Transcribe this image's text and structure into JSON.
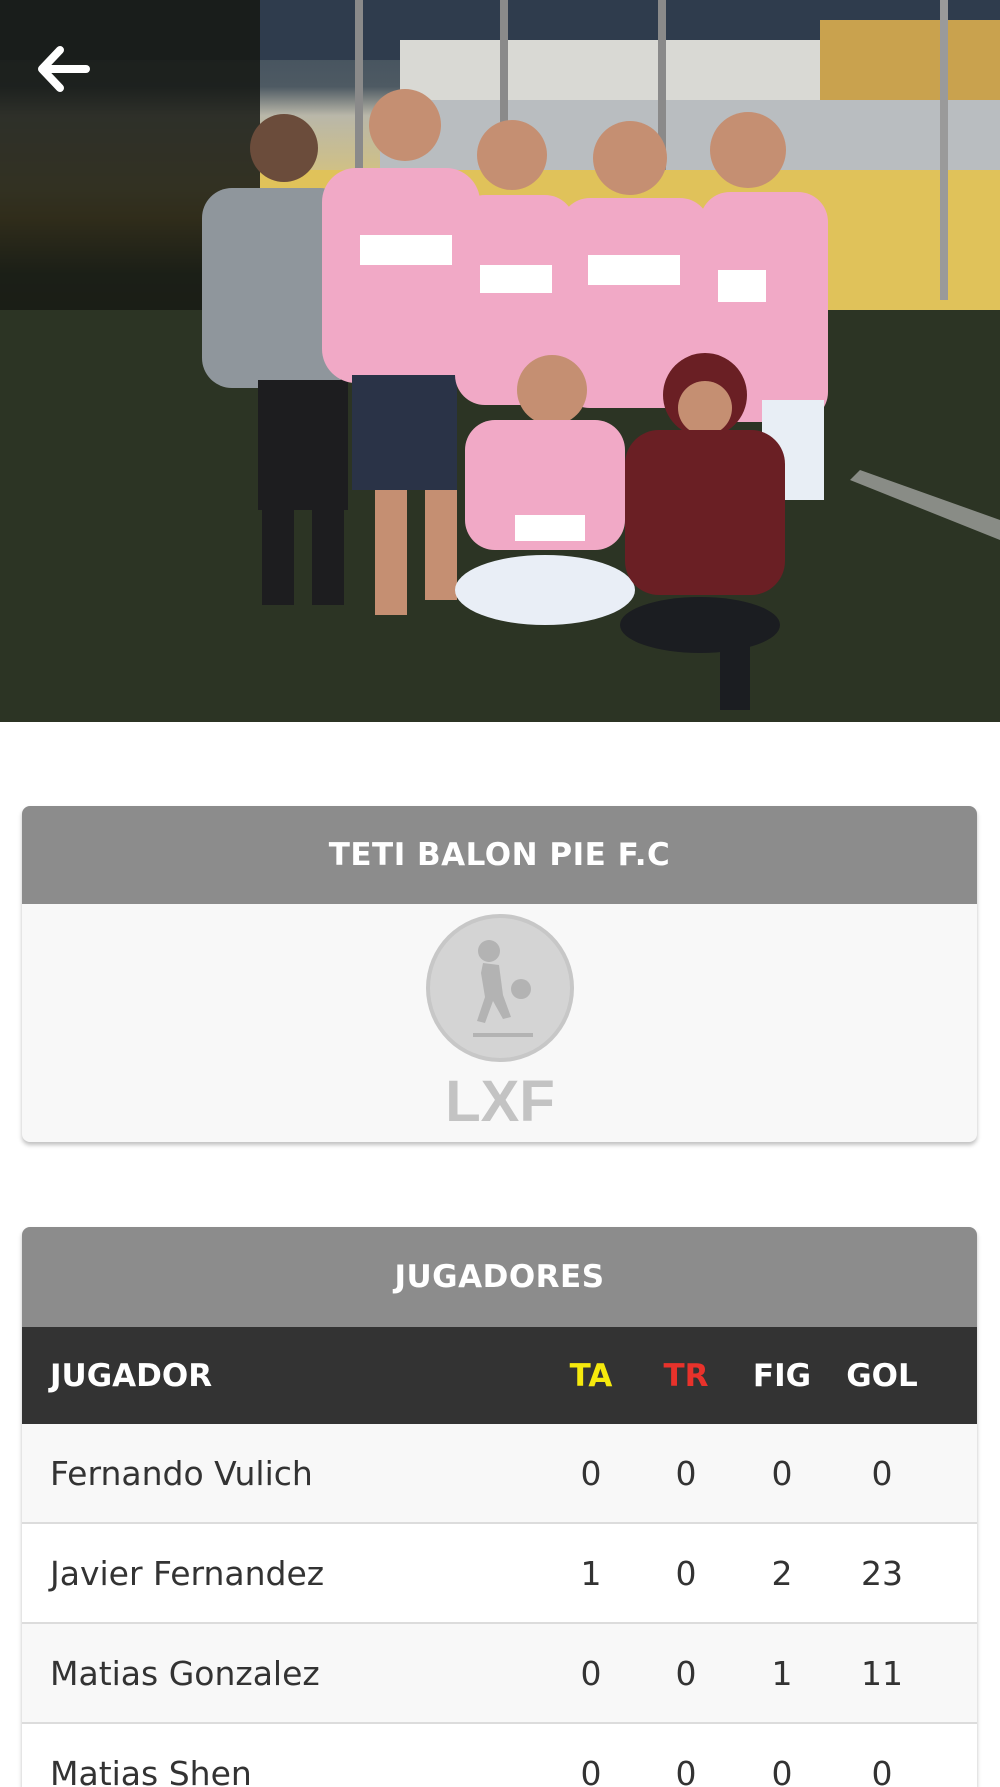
{
  "header": {
    "back_icon": "arrow-left-icon",
    "photo": "team-photo"
  },
  "team": {
    "name": "TETI BALON PIE F.C",
    "logo_text": "LXF",
    "logo_icon": "league-logo-icon"
  },
  "players_section": {
    "title": "JUGADORES",
    "columns": {
      "player": "JUGADOR",
      "yellow": "TA",
      "red": "TR",
      "fig": "FIG",
      "goals": "GOL"
    },
    "colors": {
      "yellow": "#f5e90d",
      "red": "#e8322b"
    },
    "rows": [
      {
        "name": "Fernando Vulich",
        "ta": "0",
        "tr": "0",
        "fig": "0",
        "gol": "0"
      },
      {
        "name": "Javier Fernandez",
        "ta": "1",
        "tr": "0",
        "fig": "2",
        "gol": "23"
      },
      {
        "name": "Matias Gonzalez",
        "ta": "0",
        "tr": "0",
        "fig": "1",
        "gol": "11"
      },
      {
        "name": "Matias Shen",
        "ta": "0",
        "tr": "0",
        "fig": "0",
        "gol": "0"
      }
    ]
  }
}
